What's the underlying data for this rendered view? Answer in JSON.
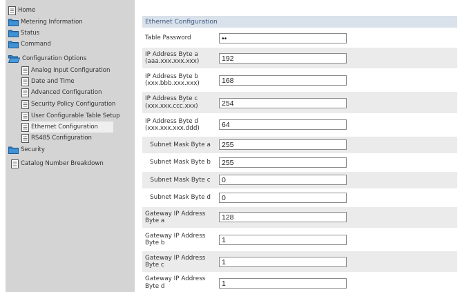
{
  "sidebar": {
    "items": [
      {
        "label": "Home",
        "icon": "document-icon"
      },
      {
        "label": "Metering Information",
        "icon": "folder-icon"
      },
      {
        "label": "Status",
        "icon": "folder-icon"
      },
      {
        "label": "Command",
        "icon": "folder-icon"
      },
      {
        "label": "Configuration Options",
        "icon": "folder-open-icon"
      },
      {
        "label": "Analog Input Configuration",
        "icon": "document-icon"
      },
      {
        "label": "Date and Time",
        "icon": "document-icon"
      },
      {
        "label": "Advanced Configuration",
        "icon": "document-icon"
      },
      {
        "label": "Security Policy Configuration",
        "icon": "document-icon"
      },
      {
        "label": "User Configurable Table Setup",
        "icon": "document-icon"
      },
      {
        "label": "Ethernet Configuration",
        "icon": "document-icon",
        "selected": true
      },
      {
        "label": "RS485 Configuration",
        "icon": "document-icon"
      },
      {
        "label": "Security",
        "icon": "folder-icon"
      },
      {
        "label": "Catalog Number Breakdown",
        "icon": "document-icon"
      }
    ]
  },
  "main": {
    "section_title": "Ethernet Configuration",
    "rows": [
      {
        "label": "Table Password",
        "value": "••"
      },
      {
        "label": "IP Address Byte a (aaa.xxx.xxx.xxx)",
        "value": "192"
      },
      {
        "label": "IP Address Byte b (xxx.bbb.xxx.xxx)",
        "value": "168"
      },
      {
        "label": "IP Address Byte c (xxx.xxx.ccc.xxx)",
        "value": "254"
      },
      {
        "label": "IP Address Byte d (xxx.xxx.xxx.ddd)",
        "value": "64"
      },
      {
        "label": "Subnet Mask Byte a",
        "value": "255"
      },
      {
        "label": "Subnet Mask Byte b",
        "value": "255"
      },
      {
        "label": "Subnet Mask Byte c",
        "value": "0"
      },
      {
        "label": "Subnet Mask Byte d",
        "value": "0"
      },
      {
        "label": "Gateway IP Address Byte a",
        "value": "128"
      },
      {
        "label": "Gateway IP Address Byte b",
        "value": "1"
      },
      {
        "label": "Gateway IP Address Byte c",
        "value": "1"
      },
      {
        "label": "Gateway IP Address Byte d",
        "value": "1"
      }
    ]
  },
  "colors": {
    "sidebar_bg": "#d4d4d4",
    "selected_bg": "#efefef",
    "header_bg": "#d9e1ea",
    "header_text": "#3c5a82",
    "row_shade": "#ebebeb",
    "folder": "#2f7fc1"
  }
}
